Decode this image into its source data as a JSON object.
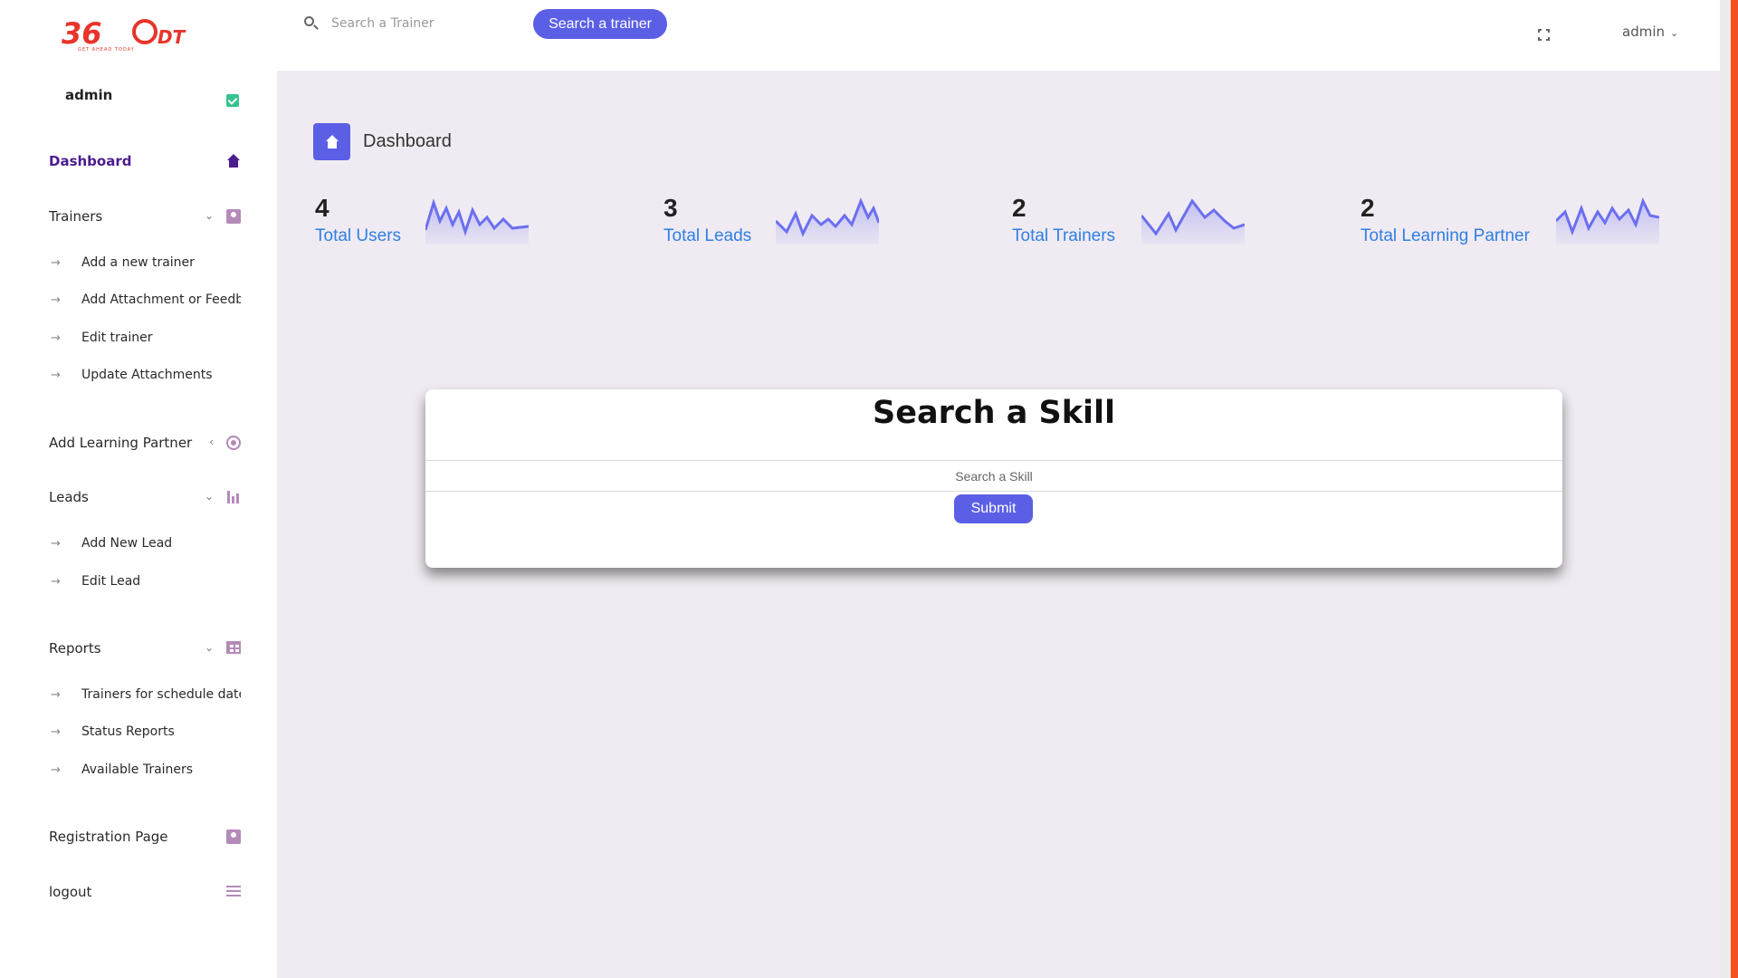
{
  "brand": {
    "logo_text": "360DT",
    "tagline": "GET AHEAD TODAY",
    "logo_color": "#e8342b"
  },
  "sidebar": {
    "user_name": "admin",
    "items": [
      {
        "label": "Dashboard",
        "icon": "home-icon",
        "active": true
      },
      {
        "label": "Trainers",
        "icon": "contact-card-icon",
        "expanded": true,
        "children": [
          {
            "label": "Add a new trainer"
          },
          {
            "label": "Add Attachment or Feedback"
          },
          {
            "label": "Edit trainer"
          },
          {
            "label": "Update Attachments"
          }
        ]
      },
      {
        "label": "Add Learning Partner",
        "icon": "target-icon",
        "expanded": false
      },
      {
        "label": "Leads",
        "icon": "bar-chart-icon",
        "expanded": true,
        "children": [
          {
            "label": "Add New Lead"
          },
          {
            "label": "Edit Lead"
          }
        ]
      },
      {
        "label": "Reports",
        "icon": "grid-icon",
        "expanded": true,
        "children": [
          {
            "label": "Trainers for schedule date"
          },
          {
            "label": "Status Reports"
          },
          {
            "label": "Available Trainers"
          }
        ]
      },
      {
        "label": "Registration Page",
        "icon": "contact-card-icon"
      },
      {
        "label": "logout",
        "icon": "list-icon"
      }
    ]
  },
  "topbar": {
    "search_placeholder": "Search a Trainer",
    "search_button": "Search a trainer",
    "user_menu": "admin"
  },
  "page": {
    "title": "Dashboard"
  },
  "stats": [
    {
      "value": "4",
      "label": "Total Users"
    },
    {
      "value": "3",
      "label": "Total Leads"
    },
    {
      "value": "2",
      "label": "Total Trainers"
    },
    {
      "value": "2",
      "label": "Total Learning Partner"
    }
  ],
  "sparkline_color": "#6b6ff0",
  "skill_search": {
    "title": "Search a Skill",
    "placeholder": "Search a Skill",
    "submit": "Submit"
  },
  "colors": {
    "accent": "#5b5fe6",
    "active_nav": "#4b1d8e",
    "link": "#2f7fe3",
    "edge": "#f4511e"
  }
}
